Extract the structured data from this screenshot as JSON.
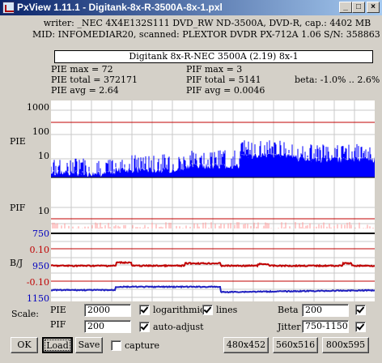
{
  "window": {
    "title": "PxView 1.11.1  -  Digitank-8x-R-3500A-8x-1.pxl",
    "minimize": "_",
    "maximize": "□",
    "close": "×"
  },
  "info": {
    "writer_line": "writer: _NEC 4X4E132S111 DVD_RW ND-3500A, DVD-R, cap.: 4402 MB",
    "mid_line": "MID: INFOMEDIAR20, scanned: PLEXTOR DVDR PX-712A 1.06 S/N: 358863 @",
    "disc_title": "Digitank 8x-R-NEC 3500A (2.19) 8x-1"
  },
  "stats": {
    "pie_max": "PIE max = 72",
    "pie_total": "PIE total = 372171",
    "pie_avg": "PIE avg = 2.64",
    "pif_max": "PIF max = 3",
    "pif_total": "PIF total = 5141",
    "pif_avg": "PIF avg = 0.0046",
    "beta": "beta: -1.0% .. 2.6%"
  },
  "graph": {
    "pie_label": "PIE",
    "pif_label": "PIF",
    "bj_label": "B/J",
    "pie_ticks": [
      "1000",
      "100",
      "10"
    ],
    "pif_ticks": [
      "10"
    ],
    "bj_ticks": [
      {
        "text": "750",
        "color": "#0000c0"
      },
      {
        "text": "0.10",
        "color": "#c00000"
      },
      {
        "text": "950",
        "color": "#0000c0"
      },
      {
        "text": "-0.10",
        "color": "#c00000"
      },
      {
        "text": "1150",
        "color": "#0000c0"
      }
    ],
    "colors": {
      "pie": "#0000ff",
      "limit": "#c00000",
      "pif": "#ff9999",
      "beta": "#c00000",
      "jitter": "#2020c0",
      "grid": "#c8c8c8"
    }
  },
  "controls": {
    "scale_label": "Scale:",
    "pie_label": "PIE",
    "pie_value": "2000",
    "pif_label": "PIF",
    "pif_value": "200",
    "logarithmic_label": "logarithmic",
    "lines_label": "lines",
    "auto_adjust_label": "auto-adjust",
    "beta_label": "Beta",
    "beta_value": "200",
    "jitter_label": "Jitter",
    "jitter_value": "750-1150",
    "capture_label": "capture",
    "logarithmic_checked": true,
    "lines_checked": true,
    "auto_adjust_checked": true,
    "beta_checked": true,
    "jitter_checked": true,
    "capture_checked": false
  },
  "buttons": {
    "ok": "OK",
    "load": "Load",
    "save": "Save",
    "size1": "480x452",
    "size2": "560x516",
    "size3": "800x595"
  }
}
